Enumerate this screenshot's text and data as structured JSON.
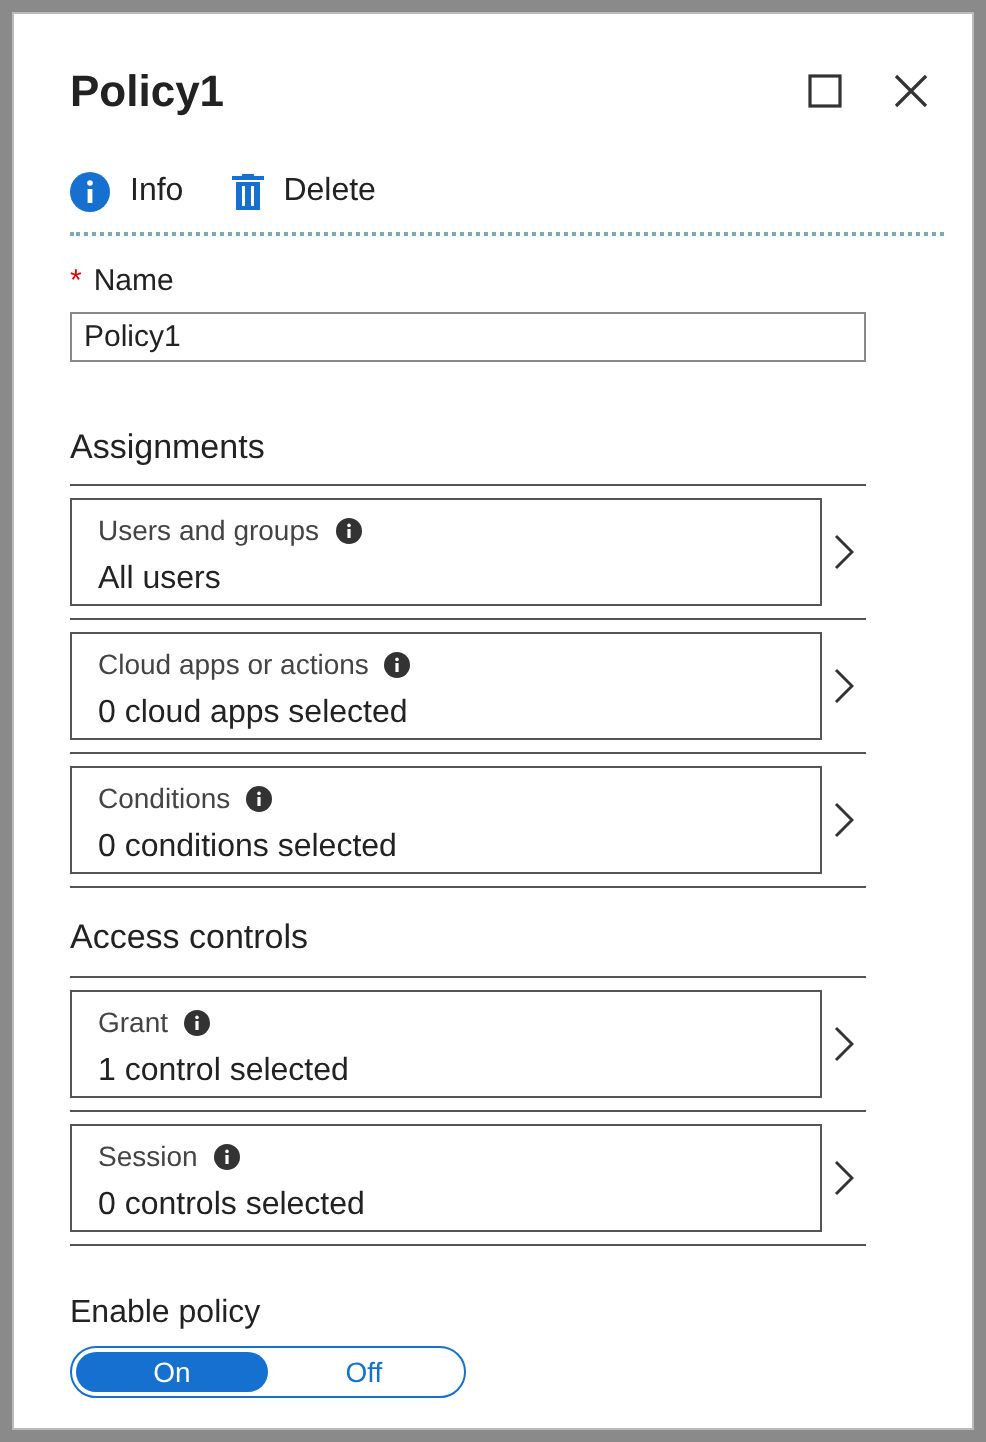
{
  "blade": {
    "title": "Policy1"
  },
  "toolbar": [
    {
      "label": "Info",
      "kind": "info"
    },
    {
      "label": "Delete",
      "kind": "delete"
    }
  ],
  "name_field": {
    "label": "Name",
    "required_mark": "*",
    "value": "Policy1"
  },
  "sections": [
    {
      "title": "Assignments",
      "items": [
        {
          "label": "Users and groups",
          "value": "All users"
        },
        {
          "label": "Cloud apps or actions",
          "value": "0 cloud apps selected"
        },
        {
          "label": "Conditions",
          "value": "0 conditions selected"
        }
      ]
    },
    {
      "title": "Access controls",
      "items": [
        {
          "label": "Grant",
          "value": "1 control selected"
        },
        {
          "label": "Session",
          "value": "0 controls selected"
        }
      ]
    }
  ],
  "enable_policy": {
    "label": "Enable policy",
    "options": [
      {
        "label": "On",
        "selected": true
      },
      {
        "label": "Off",
        "selected": false
      }
    ]
  }
}
